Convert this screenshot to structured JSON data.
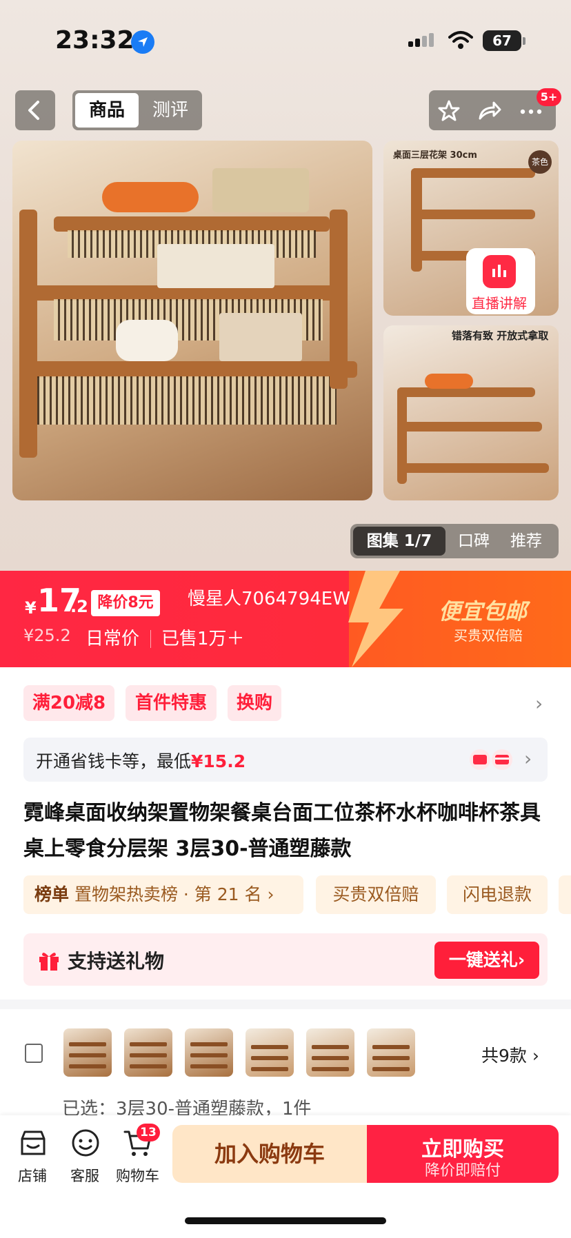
{
  "status_bar": {
    "time": "23:32",
    "battery": "67"
  },
  "nav": {
    "tab_product": "商品",
    "tab_review": "测评",
    "more_badge": "5+"
  },
  "images": {
    "thumb1_caption": "桌面三层花架 30cm",
    "thumb1_tag": "茶色",
    "thumb2_caption": "错落有致 开放式拿取",
    "live_label": "直播讲解"
  },
  "gallery": {
    "active": "图集 1/7",
    "reviews": "口碑",
    "recommend": "推荐"
  },
  "price": {
    "currency": "¥",
    "integer": "17",
    "decimal": ".2",
    "drop_label": "降价8元",
    "user": "慢星人7064794EW",
    "original": "¥25.2",
    "daily_label": "日常价",
    "sold": "已售1万＋",
    "promo_title": "便宜包邮",
    "promo_sub": "买贵双倍赔"
  },
  "promos": [
    "满20减8",
    "首件特惠",
    "换购"
  ],
  "saver": {
    "text": "开通省钱卡等，最低",
    "price": "¥15.2"
  },
  "title": "霓峰桌面收纳架置物架餐桌台面工位茶杯水杯咖啡杯茶具桌上零食分层架 3层30-普通塑藤款",
  "rank": {
    "label": "榜单",
    "text": "置物架热卖榜 · 第 21 名 ›"
  },
  "guarantees": [
    "买贵双倍赔",
    "闪电退款"
  ],
  "gift": {
    "text": "支持送礼物",
    "button": "一键送礼›"
  },
  "skus": {
    "total": "共9款 ›",
    "selected": "已选：3层30-普通塑藤款，1件"
  },
  "bottom": {
    "store": "店铺",
    "service": "客服",
    "cart": "购物车",
    "cart_count": "13",
    "add_cart": "加入购物车",
    "buy": "立即购买",
    "buy_sub": "降价即赔付"
  }
}
